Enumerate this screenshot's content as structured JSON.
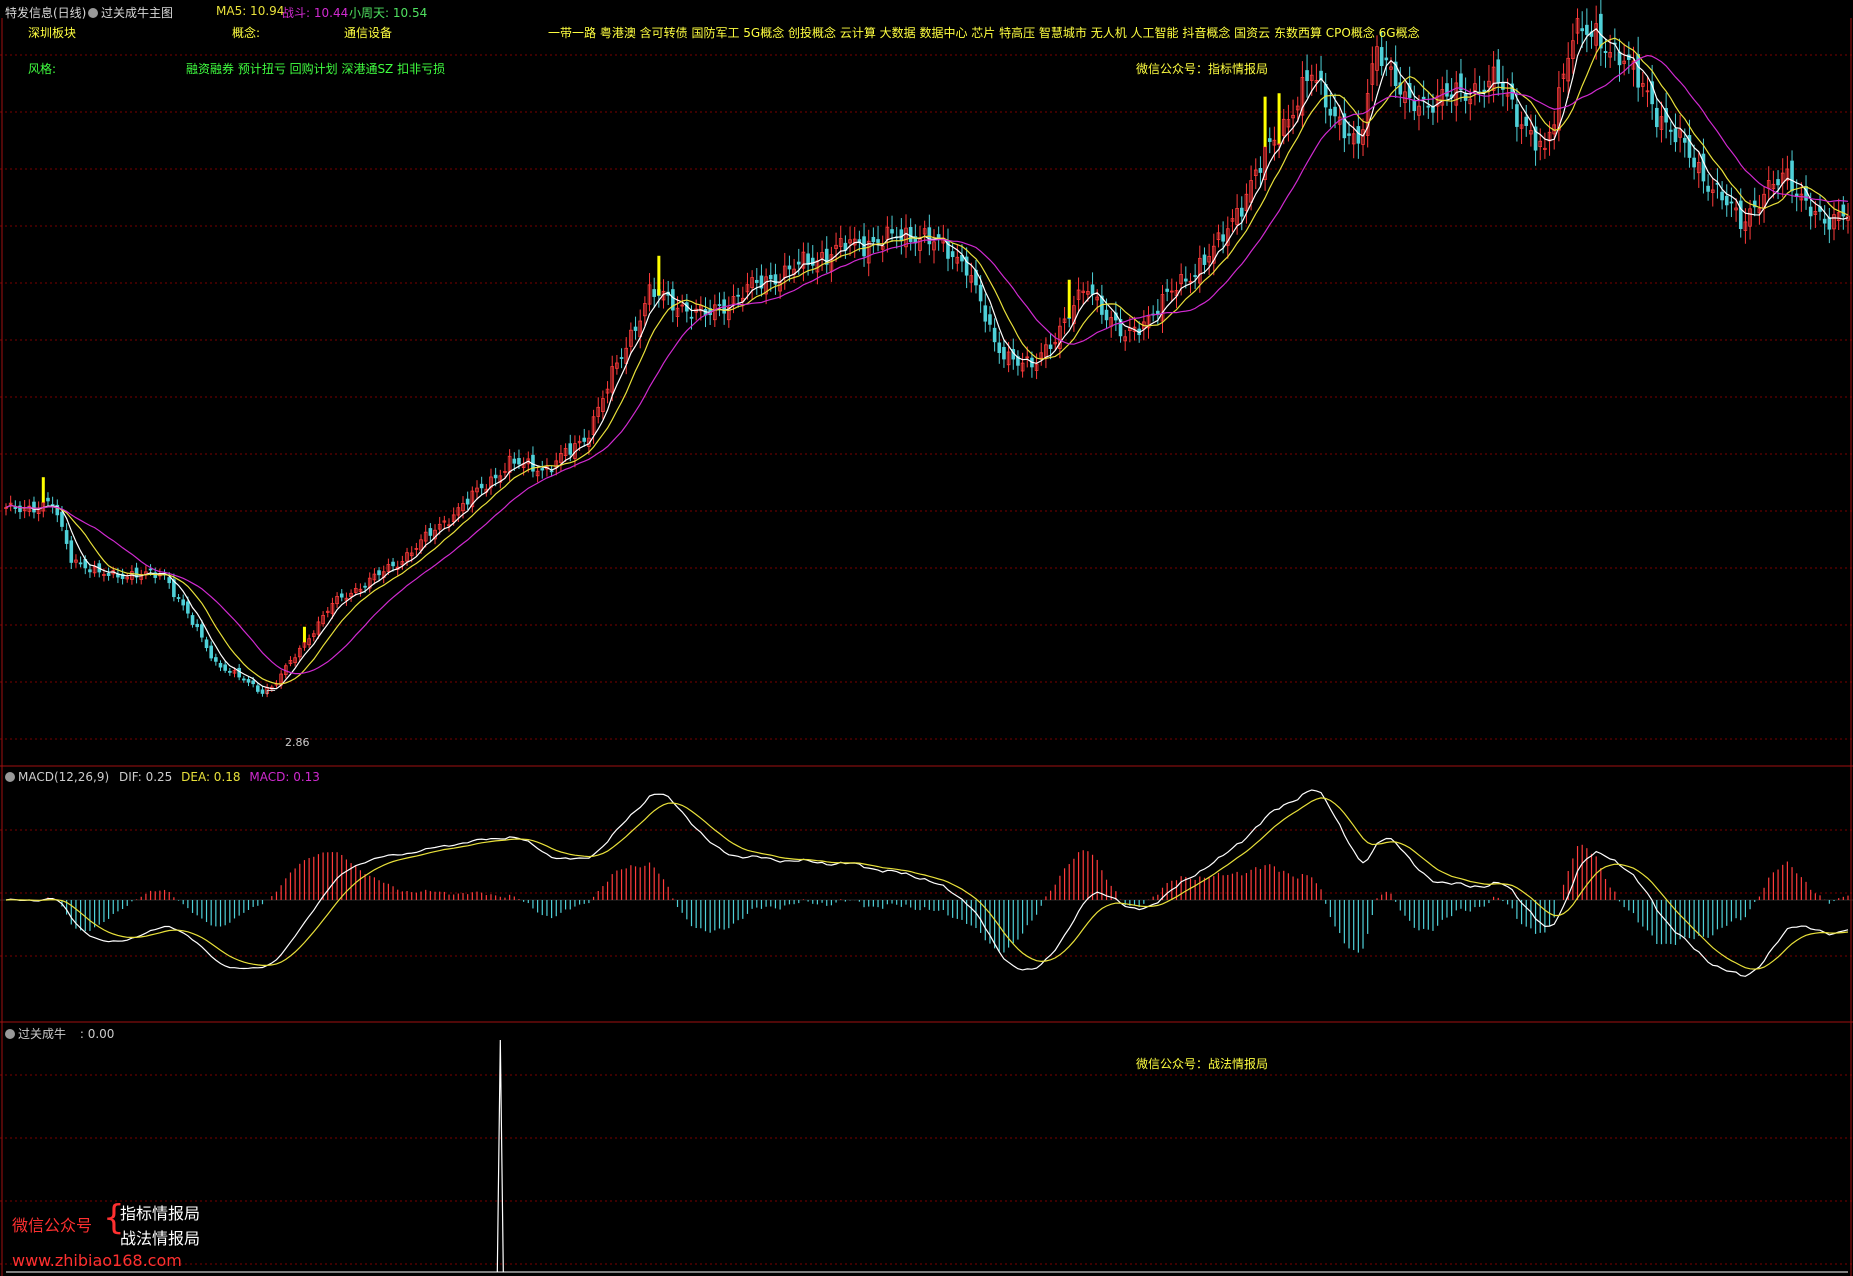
{
  "header": {
    "title": "特发信息(日线)",
    "indicator_name": "过关成牛主图",
    "ma5_label": "MA5: 10.94",
    "zhandou_label": "战斗: 10.44",
    "xiaozhoutian_label": "小周天: 10.54"
  },
  "info": {
    "board_label": "深圳板块",
    "concept_key": "概念:",
    "concept_value": "通信设备",
    "concept_list": "一带一路 粤港澳 含可转债 国防军工 5G概念 创投概念 云计算 大数据 数据中心 芯片 特高压 智慧城市 无人机 人工智能 抖音概念 国资云 东数西算 CPO概念 6G概念",
    "style_key": "风格:",
    "style_value": "融资融券 预计扭亏 回购计划 深港通SZ 扣非亏损",
    "wechat_main": "微信公众号：指标情报局"
  },
  "colors": {
    "background": "#000000",
    "grid": "#7a0000",
    "up": "#ff3b3b",
    "down": "#4fd0d8",
    "ma_white": "#ffffff",
    "ma_yellow": "#e8e03a",
    "ma_magenta": "#d02ad0",
    "signal": "#ffff00",
    "separator": "#a01010"
  },
  "chart_data": [
    {
      "type": "candlestick",
      "title": "过关成牛主图",
      "series": [
        {
          "name": "MA5",
          "last": 10.94
        },
        {
          "name": "战斗",
          "last": 10.44
        },
        {
          "name": "小周天",
          "last": 10.54
        }
      ],
      "ylim": [
        2.0,
        14.0
      ],
      "low_annotation": {
        "label": "2.86",
        "value": 2.86,
        "index": 56
      },
      "anchors": [
        [
          0,
          6.0
        ],
        [
          10,
          6.1
        ],
        [
          14,
          5.2
        ],
        [
          20,
          4.9
        ],
        [
          34,
          4.9
        ],
        [
          45,
          3.4
        ],
        [
          56,
          2.86
        ],
        [
          70,
          4.4
        ],
        [
          84,
          5.1
        ],
        [
          94,
          5.8
        ],
        [
          108,
          6.8
        ],
        [
          116,
          6.7
        ],
        [
          124,
          7.2
        ],
        [
          138,
          9.7
        ],
        [
          150,
          9.3
        ],
        [
          160,
          9.8
        ],
        [
          180,
          10.5
        ],
        [
          196,
          10.7
        ],
        [
          206,
          10.2
        ],
        [
          212,
          8.8
        ],
        [
          220,
          8.4
        ],
        [
          232,
          9.8
        ],
        [
          240,
          8.9
        ],
        [
          250,
          9.7
        ],
        [
          260,
          10.5
        ],
        [
          272,
          12.3
        ],
        [
          280,
          13.4
        ],
        [
          290,
          12.1
        ],
        [
          294,
          14.0
        ],
        [
          300,
          12.9
        ],
        [
          308,
          13.0
        ],
        [
          320,
          13.3
        ],
        [
          330,
          12.0
        ],
        [
          336,
          14.2
        ],
        [
          346,
          13.8
        ],
        [
          354,
          12.8
        ],
        [
          364,
          11.7
        ],
        [
          372,
          10.9
        ],
        [
          376,
          11.3
        ],
        [
          382,
          11.7
        ],
        [
          390,
          10.8
        ],
        [
          395,
          11.2
        ]
      ],
      "signal_bars": [
        8,
        64,
        140,
        228,
        270,
        273
      ]
    },
    {
      "type": "bar",
      "title": "MACD(12,26,9)",
      "labels": {
        "name": "MACD(12,26,9)",
        "dif": "DIF: 0.25",
        "dea": "DEA: 0.18",
        "macd": "MACD: 0.13"
      },
      "series": [
        {
          "name": "DIF",
          "last": 0.25
        },
        {
          "name": "DEA",
          "last": 0.18
        },
        {
          "name": "MACD",
          "last": 0.13
        }
      ]
    },
    {
      "type": "line",
      "title": "过关成牛",
      "value_label": ": 0.00",
      "spike_index": 106,
      "spike_value": 1
    }
  ],
  "bottom": {
    "wechat": "微信公众号：战法情报局",
    "watermark_prefix": "微信公众号",
    "watermark_line1": "指标情报局",
    "watermark_line2": "战法情报局",
    "watermark_url": "www.zhibiao168.com"
  }
}
